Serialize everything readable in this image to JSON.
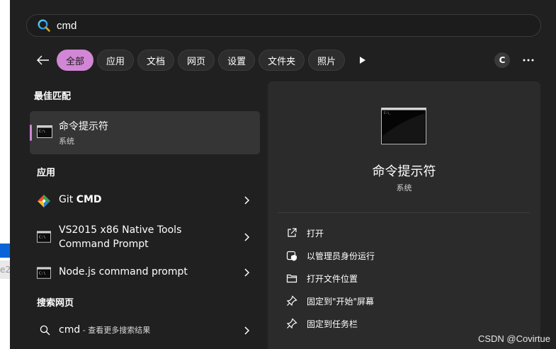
{
  "background_edge": {
    "text": "e2"
  },
  "search": {
    "value": "cmd"
  },
  "filters": {
    "items": [
      {
        "label": "全部",
        "active": true
      },
      {
        "label": "应用"
      },
      {
        "label": "文档"
      },
      {
        "label": "网页"
      },
      {
        "label": "设置"
      },
      {
        "label": "文件夹"
      },
      {
        "label": "照片"
      }
    ],
    "account_initial": "C"
  },
  "best_match": {
    "heading": "最佳匹配",
    "title": "命令提示符",
    "subtitle": "系统"
  },
  "apps": {
    "heading": "应用",
    "items": [
      {
        "prefix": "Git ",
        "bold": "CMD",
        "icon": "git-icon"
      },
      {
        "line1": "VS2015 x86 Native Tools",
        "line2": "Command Prompt",
        "icon": "console-icon"
      },
      {
        "label": "Node.js command prompt",
        "icon": "console-icon"
      }
    ]
  },
  "web": {
    "heading": "搜索网页",
    "query": "cmd",
    "suffix": " - 查看更多搜索结果"
  },
  "preview": {
    "name": "命令提示符",
    "subtitle": "系统",
    "actions": [
      {
        "label": "打开",
        "icon": "open-external-icon"
      },
      {
        "label": "以管理员身份运行",
        "icon": "shield-admin-icon"
      },
      {
        "label": "打开文件位置",
        "icon": "folder-icon"
      },
      {
        "label": "固定到\"开始\"屏幕",
        "icon": "pin-icon"
      },
      {
        "label": "固定到任务栏",
        "icon": "pin-icon"
      }
    ]
  },
  "watermark": "CSDN @Covirtue",
  "colors": {
    "accent": "#d286d6",
    "panel": "#202020",
    "pane": "#2b2b2b",
    "selected": "#353535"
  }
}
